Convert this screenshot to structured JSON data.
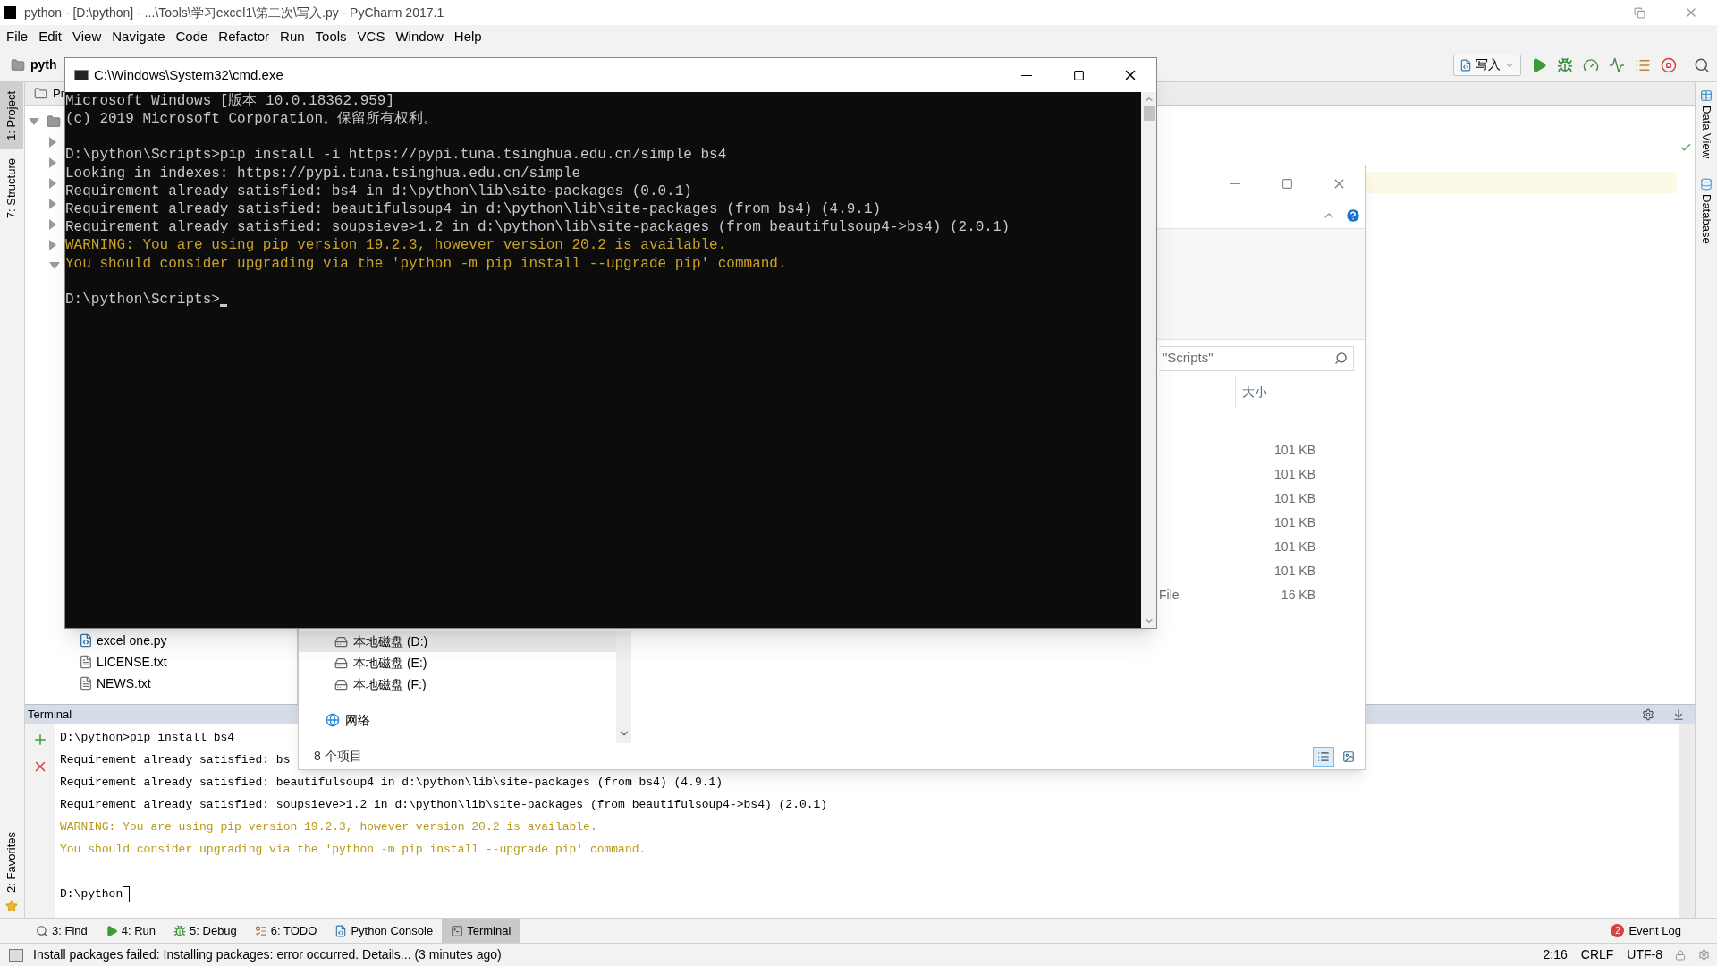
{
  "ide": {
    "title": "python - [D:\\python] - ...\\Tools\\学习excel1\\第二次\\写入.py - PyCharm 2017.1",
    "menu": [
      "File",
      "Edit",
      "View",
      "Navigate",
      "Code",
      "Refactor",
      "Run",
      "Tools",
      "VCS",
      "Window",
      "Help"
    ],
    "nav_crumb": "pyth",
    "run_config": "写入",
    "left_tools": [
      {
        "label": "1: Project",
        "selected": true
      },
      {
        "label": "7: Structure",
        "selected": false
      }
    ],
    "favorites_tool": "2: Favorites",
    "right_tools": [
      {
        "label": "Data View",
        "kind": "table"
      },
      {
        "label": "Database",
        "kind": "database"
      }
    ],
    "project_header": "Pr",
    "project_tree": {
      "expanded": true,
      "children": [
        {
          "expanded": false
        },
        {
          "expanded": false
        },
        {
          "expanded": false
        },
        {
          "expanded": false
        },
        {
          "expanded": false
        },
        {
          "expanded": false
        },
        {
          "expanded": true,
          "children": [
            {
              "label": "excel one.py",
              "kind": "python"
            },
            {
              "label": "LICENSE.txt",
              "kind": "text"
            },
            {
              "label": "NEWS.txt",
              "kind": "text"
            }
          ]
        }
      ]
    },
    "terminal": {
      "title": "Terminal",
      "lines": [
        {
          "text": "D:\\python>pip install bs4",
          "kind": "normal"
        },
        {
          "text": "Requirement already satisfied: bs",
          "kind": "normal"
        },
        {
          "text": "Requirement already satisfied: beautifulsoup4 in d:\\python\\lib\\site-packages (from bs4) (4.9.1)",
          "kind": "normal"
        },
        {
          "text": "Requirement already satisfied: soupsieve>1.2 in d:\\python\\lib\\site-packages (from beautifulsoup4->bs4) (2.0.1)",
          "kind": "normal"
        },
        {
          "text": "WARNING: You are using pip version 19.2.3, however version 20.2 is available.",
          "kind": "warning"
        },
        {
          "text": "You should consider upgrading via the 'python -m pip install --upgrade pip' command.",
          "kind": "warning"
        }
      ],
      "prompt": "D:\\python"
    },
    "bottom_tools": [
      {
        "label": "3: Find",
        "kind": "find",
        "selected": false
      },
      {
        "label": "4: Run",
        "kind": "run",
        "selected": false
      },
      {
        "label": "5: Debug",
        "kind": "debug",
        "selected": false
      },
      {
        "label": "6: TODO",
        "kind": "todo",
        "selected": false
      },
      {
        "label": "Python Console",
        "kind": "console",
        "selected": false
      },
      {
        "label": "Terminal",
        "kind": "terminal",
        "selected": true
      }
    ],
    "event_log": {
      "label": "Event Log",
      "count": "2"
    },
    "status": {
      "message": "Install packages failed: Installing packages: error occurred. Details... (3 minutes ago)",
      "position": "2:16",
      "line_separator": "CRLF",
      "encoding": "UTF-8"
    }
  },
  "cmd": {
    "title": "C:\\Windows\\System32\\cmd.exe",
    "blocks": [
      [
        {
          "text": "Microsoft Windows [版本 10.0.18362.959]",
          "kind": "normal"
        },
        {
          "text": "(c) 2019 Microsoft Corporation。保留所有权利。",
          "kind": "normal"
        }
      ],
      [
        {
          "text": "D:\\python\\Scripts>pip install -i https://pypi.tuna.tsinghua.edu.cn/simple bs4",
          "kind": "normal"
        },
        {
          "text": "Looking in indexes: https://pypi.tuna.tsinghua.edu.cn/simple",
          "kind": "normal"
        },
        {
          "text": "Requirement already satisfied: bs4 in d:\\python\\lib\\site-packages (0.0.1)",
          "kind": "normal"
        },
        {
          "text": "Requirement already satisfied: beautifulsoup4 in d:\\python\\lib\\site-packages (from bs4) (4.9.1)",
          "kind": "normal"
        },
        {
          "text": "Requirement already satisfied: soupsieve>1.2 in d:\\python\\lib\\site-packages (from beautifulsoup4->bs4) (2.0.1)",
          "kind": "normal"
        },
        {
          "text": "WARNING: You are using pip version 19.2.3, however version 20.2 is available.",
          "kind": "warning"
        },
        {
          "text": "You should consider upgrading via the 'python -m pip install --upgrade pip' command.",
          "kind": "warning"
        }
      ]
    ],
    "prompt": "D:\\python\\Scripts>"
  },
  "explorer": {
    "search_placeholder": "\"Scripts\"",
    "size_column": "大小",
    "rows": [
      {
        "size": "101 KB"
      },
      {
        "size": "101 KB"
      },
      {
        "size": "101 KB"
      },
      {
        "size": "101 KB"
      },
      {
        "size": "101 KB"
      },
      {
        "size": "101 KB"
      },
      {
        "type": "File",
        "size": "16 KB"
      }
    ],
    "nav": [
      {
        "label": "本地磁盘 (D:)",
        "kind": "drive",
        "selected": true
      },
      {
        "label": "本地磁盘 (E:)",
        "kind": "drive",
        "selected": false
      },
      {
        "label": "本地磁盘 (F:)",
        "kind": "drive",
        "selected": false
      },
      {
        "label": "网络",
        "kind": "network",
        "selected": false
      }
    ],
    "status": "8 个项目",
    "view_modes": [
      {
        "kind": "details",
        "selected": true
      },
      {
        "kind": "thumbnails",
        "selected": false
      }
    ]
  }
}
